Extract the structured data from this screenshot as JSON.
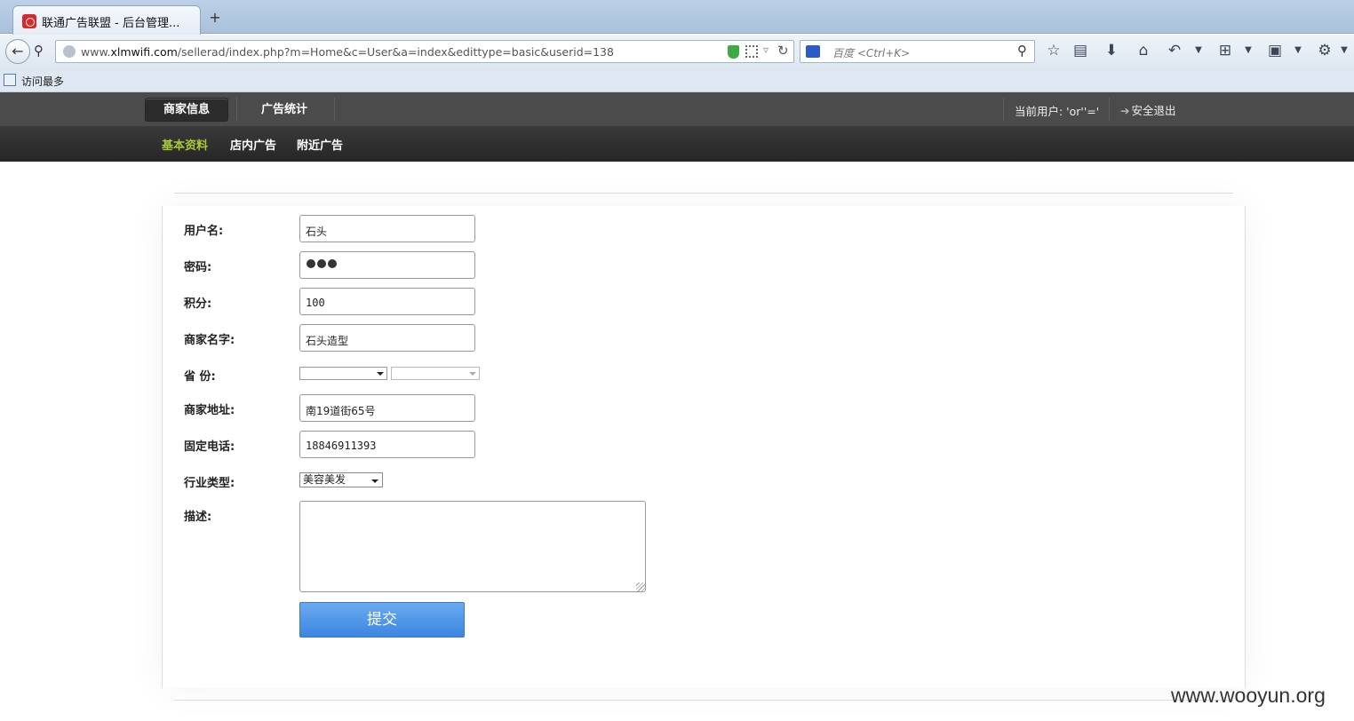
{
  "browser": {
    "tab_title": "联通广告联盟 - 后台管理...",
    "new_tab": "+",
    "url_prefix": "www.",
    "url_domain": "xlmwifi.com",
    "url_path": "/sellerad/index.php?m=Home&c=User&a=index&edittype=basic&userid=138",
    "search_placeholder": "百度 <Ctrl+K>",
    "bookmark_label": "访问最多",
    "icons": {
      "back": "back-arrow-icon",
      "site_info": "key-icon",
      "reload": "reload-icon",
      "search": "magnifier-icon"
    }
  },
  "header": {
    "tabs": [
      {
        "label": "商家信息",
        "active": true
      },
      {
        "label": "广告统计",
        "active": false
      }
    ],
    "current_user": "当前用户: 'or''='",
    "logout_label": "安全退出"
  },
  "subnav": {
    "items": [
      {
        "label": "基本资料",
        "active": true
      },
      {
        "label": "店内广告",
        "active": false
      },
      {
        "label": "附近广告",
        "active": false
      }
    ],
    "active_color": "#a8c83a"
  },
  "form": {
    "username_label": "用户名:",
    "username_value": "石头",
    "password_label": "密码:",
    "points_label": "积分:",
    "points_value": "100",
    "shop_name_label": "商家名字:",
    "shop_name_value": "石头造型",
    "province_label": "省 份:",
    "address_label": "商家地址:",
    "address_value": "南19道街65号",
    "phone_label": "固定电话:",
    "phone_value": "18846911393",
    "industry_label": "行业类型:",
    "industry_value": "美容美发",
    "description_label": "描述:",
    "description_value": "",
    "submit_label": "提交",
    "submit_color": "#4a93e8"
  },
  "watermark": "www.wooyun.org"
}
